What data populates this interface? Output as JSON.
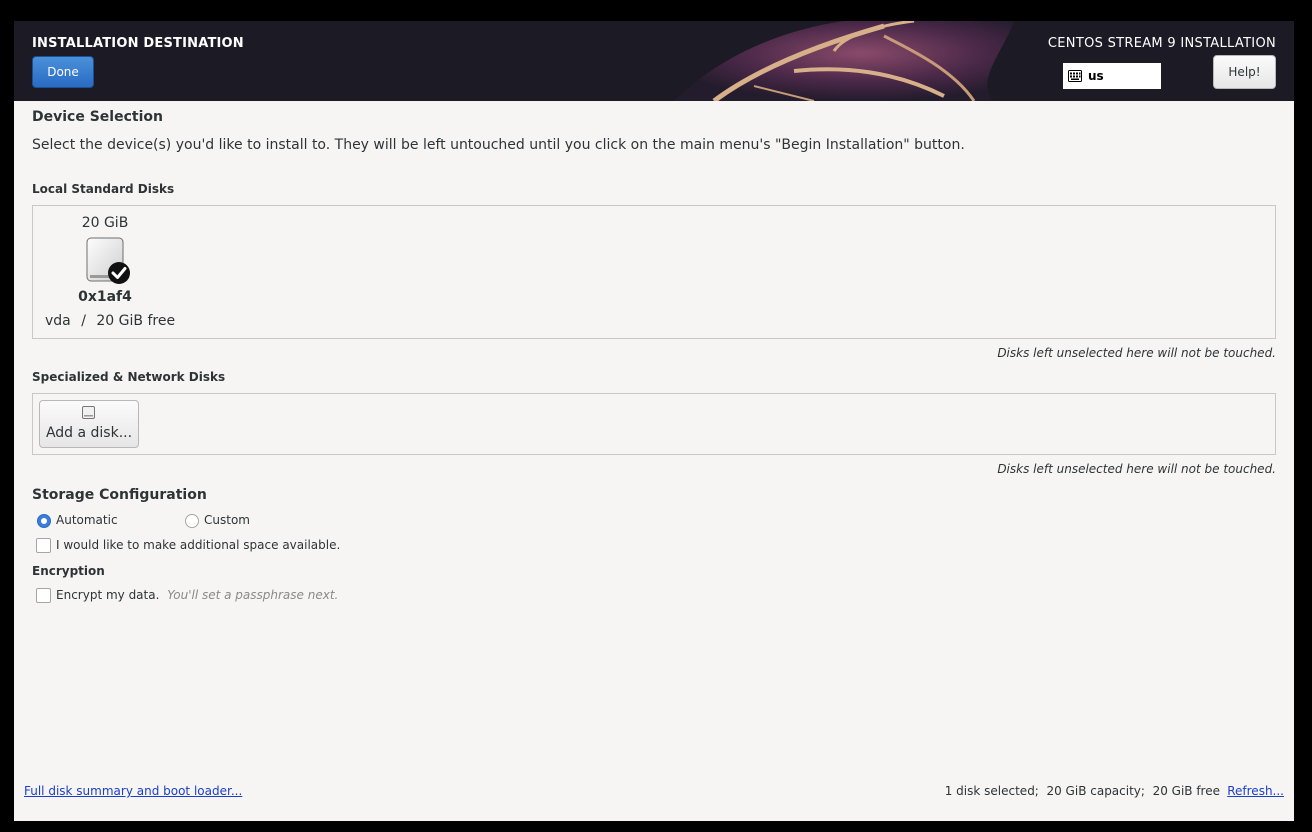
{
  "header": {
    "spoke_title": "INSTALLATION DESTINATION",
    "done_label": "Done",
    "product_title": "CENTOS STREAM 9 INSTALLATION",
    "keyboard_layout": "us",
    "help_label": "Help!"
  },
  "device_selection": {
    "title": "Device Selection",
    "description": "Select the device(s) you'd like to install to.  They will be left untouched until you click on the main menu's \"Begin Installation\" button."
  },
  "local_disks": {
    "label": "Local Standard Disks",
    "disks": [
      {
        "size": "20 GiB",
        "name": "0x1af4",
        "device": "vda",
        "separator": "/",
        "free": "20 GiB free",
        "selected": true
      }
    ],
    "hint": "Disks left unselected here will not be touched."
  },
  "network_disks": {
    "label": "Specialized & Network Disks",
    "add_label": "Add a disk...",
    "hint": "Disks left unselected here will not be touched."
  },
  "storage_config": {
    "title": "Storage Configuration",
    "automatic_label": "Automatic",
    "custom_label": "Custom",
    "selected": "Automatic",
    "reclaim_label": "I would like to make additional space available.",
    "reclaim_checked": false
  },
  "encryption": {
    "title": "Encryption",
    "encrypt_label": "Encrypt my data.",
    "encrypt_hint": "You'll set a passphrase next.",
    "encrypt_checked": false
  },
  "footer": {
    "summary_link": "Full disk summary and boot loader...",
    "status": "1 disk selected;  20 GiB capacity;  20 GiB free",
    "refresh_link": "Refresh..."
  },
  "colors": {
    "accent": "#3b7dd8",
    "link": "#1b3fc7",
    "header_bg": "#1c1a24"
  }
}
